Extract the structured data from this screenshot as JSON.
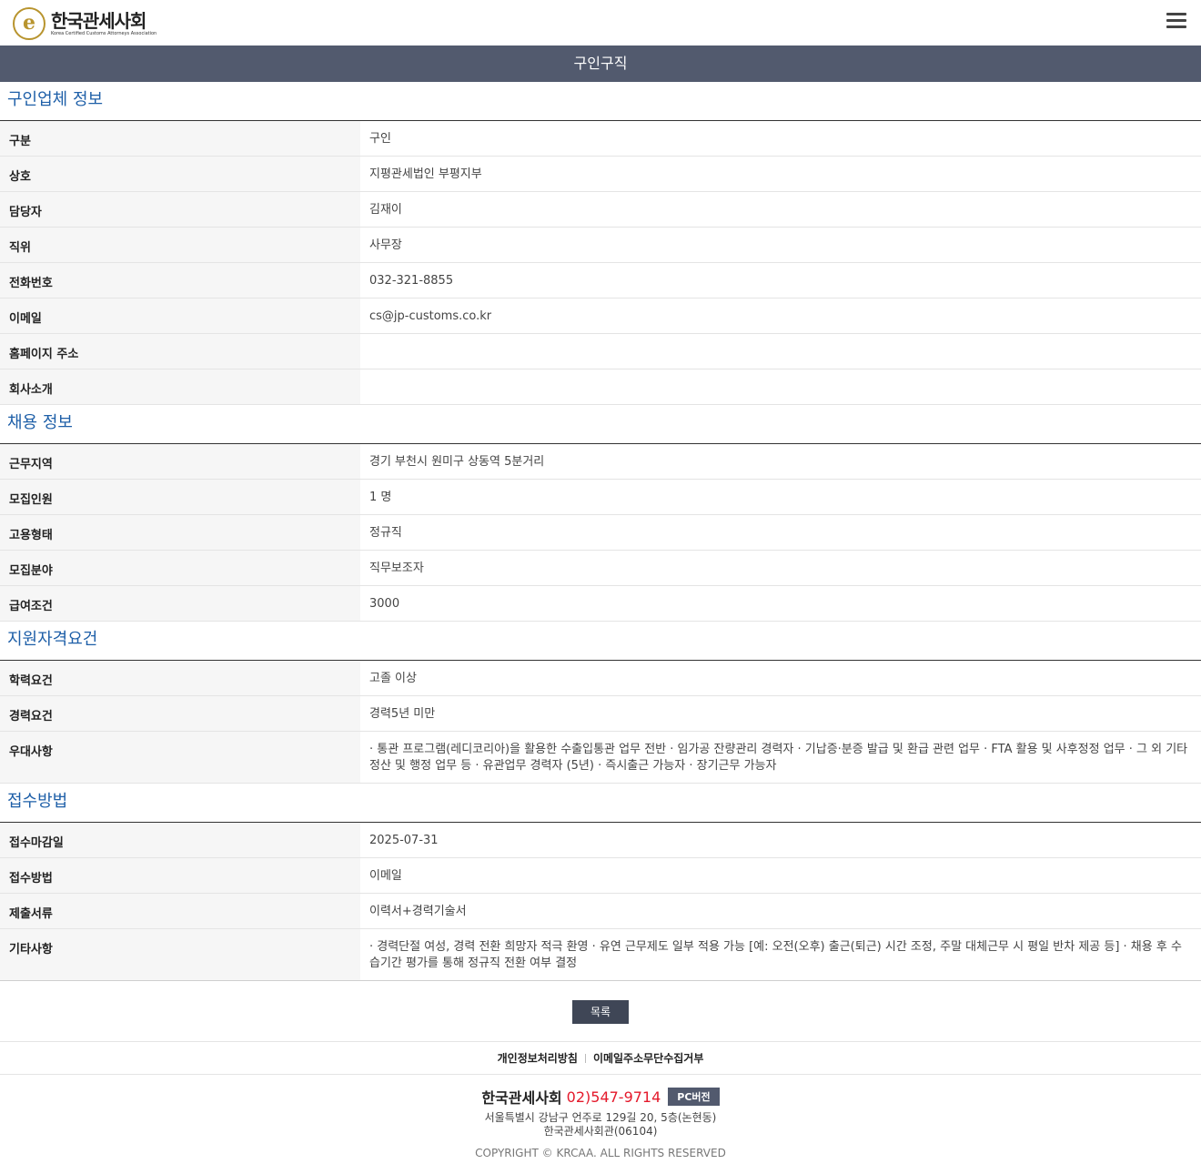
{
  "header": {
    "logo_ko": "한국관세사회",
    "logo_en": "Korea Certified Customs Attorneys Association",
    "logo_mark": "e"
  },
  "page_title": "구인구직",
  "sections": {
    "company": {
      "title": "구인업체 정보",
      "rows": [
        {
          "label": "구분",
          "value": "구인"
        },
        {
          "label": "상호",
          "value": "지평관세법인 부평지부"
        },
        {
          "label": "담당자",
          "value": "김재이"
        },
        {
          "label": "직위",
          "value": "사무장"
        },
        {
          "label": "전화번호",
          "value": "032-321-8855"
        },
        {
          "label": "이메일",
          "value": "cs@jp-customs.co.kr"
        },
        {
          "label": "홈페이지 주소",
          "value": ""
        },
        {
          "label": "회사소개",
          "value": ""
        }
      ]
    },
    "hiring": {
      "title": "채용 정보",
      "rows": [
        {
          "label": "근무지역",
          "value": "경기 부천시 원미구 상동역 5분거리"
        },
        {
          "label": "모집인원",
          "value": "1 명"
        },
        {
          "label": "고용형태",
          "value": "정규직"
        },
        {
          "label": "모집분야",
          "value": "직무보조자"
        },
        {
          "label": "급여조건",
          "value": "3000"
        }
      ]
    },
    "qualification": {
      "title": "지원자격요건",
      "rows": [
        {
          "label": "학력요건",
          "value": "고졸 이상"
        },
        {
          "label": "경력요건",
          "value": "경력5년 미만"
        },
        {
          "label": "우대사항",
          "value": "· 통관 프로그램(레디코리아)을 활용한 수출입통관 업무 전반  · 임가공 잔량관리 경력자  · 기납증·분증 발급 및 환급 관련 업무  · FTA 활용 및 사후정정 업무  · 그 외 기타 정산 및 행정 업무 등  · 유관업무 경력자 (5년)  · 즉시출근 가능자  · 장기근무 가능자"
        }
      ]
    },
    "application": {
      "title": "접수방법",
      "rows": [
        {
          "label": "접수마감일",
          "value": "2025-07-31"
        },
        {
          "label": "접수방법",
          "value": "이메일"
        },
        {
          "label": "제출서류",
          "value": "이력서+경력기술서"
        },
        {
          "label": "기타사항",
          "value": "· 경력단절 여성, 경력 전환 희망자 적극 환영  · 유연 근무제도 일부 적용 가능 [예: 오전(오후) 출근(퇴근) 시간 조정, 주말 대체근무 시 평일 반차 제공 등]  · 채용 후 수습기간 평가를 통해 정규직 전환 여부 결정"
        }
      ]
    }
  },
  "buttons": {
    "list": "목록",
    "pc_version": "PC버전"
  },
  "footer": {
    "link_privacy": "개인정보처리방침",
    "link_email": "이메일주소무단수집거부",
    "org_name": "한국관세사회",
    "phone": "02)547-9714",
    "address1": "서울특별시 강남구 언주로 129길 20, 5층(논현동)",
    "address2": "한국관세사회관(06104)",
    "copyright": "COPYRIGHT © KRCAA. ALL RIGHTS RESERVED"
  },
  "colors": {
    "title_bar": "#525a6e",
    "section_title": "#1e5fa8",
    "phone": "#e4192b",
    "logo_gold": "#b8942e"
  }
}
